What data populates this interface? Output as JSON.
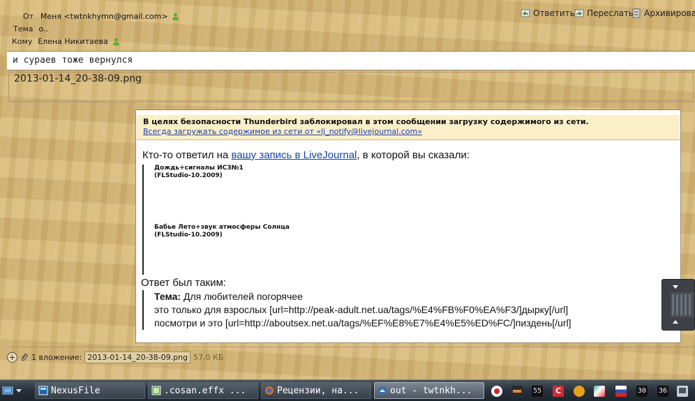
{
  "header": {
    "from_label": "От",
    "from_value": "Меня <twtnkhymn@gmail.com>",
    "subject_label": "Тема",
    "subject_value": "о..",
    "to_label": "Кому",
    "to_value": "Елена Никитаева",
    "actions": {
      "reply": "Ответить",
      "forward": "Переслать",
      "archive": "Архивировать"
    }
  },
  "subject_line": "и сураев тоже вернулся",
  "attachment_box_title": "2013-01-14_20-38-09.png",
  "notice": {
    "text": "В целях безопасности Thunderbird заблокировал в этом сообщении загрузку содержимого из сети.",
    "link": "Всегда загружать содержимое из сети от «lj_notify@livejournal.com»"
  },
  "body": {
    "intro_before": "Кто-то ответил на ",
    "intro_link": "вашу запись в LiveJournal",
    "intro_after": ", в которой вы сказали:",
    "quote": {
      "line1": "Дождь+сигналы ИСЗ№1",
      "line2": "(FLStudio-10.2009)",
      "line3": "Бабье Лето+звук атмосферы Солнца",
      "line4": "(FLStudio-10.2009)"
    },
    "reply_label": "Ответ был таким:",
    "reply": {
      "theme_label": "Тема:",
      "theme_value": " Для любителей погорячее",
      "line1": "это только для взрослых [url=http://peak-adult.net.ua/tags/%E4%FB%F0%EA%F3/]дырку[/url]",
      "line2": "посмотри и это [url=http://aboutsex.net.ua/tags/%EF%E8%E7%E4%E5%ED%FC/]пиздень[/url]"
    }
  },
  "attachments": {
    "count_label": "1 вложение:",
    "file_name": "2013-01-14_20-38-09.png",
    "file_size": "57,0 КБ"
  },
  "taskbar": {
    "tasks": [
      "NexusFile",
      ".cosan.effx ...",
      "Рецензии, на...",
      "out - twtnkh..."
    ],
    "tray_counters": [
      "55",
      "30",
      "36"
    ]
  },
  "colors": {
    "wood_background": "#d6b87a",
    "link": "#1a3fb0",
    "notice_bg": "#faefc8",
    "taskbar": "#27303a"
  }
}
